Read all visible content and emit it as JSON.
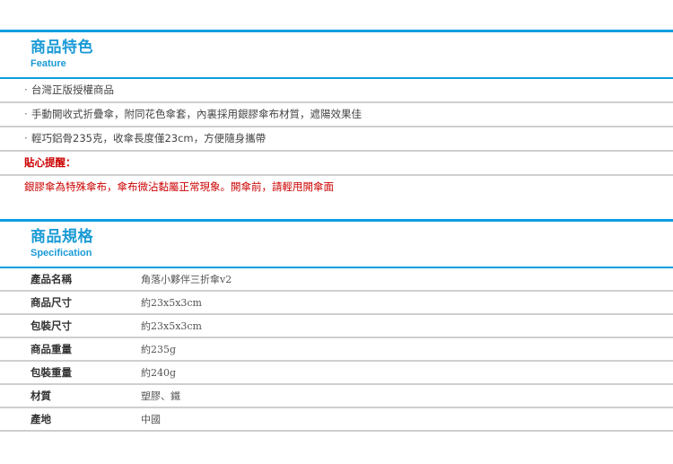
{
  "features_section": {
    "title_zh": "商品特色",
    "title_en": "Feature",
    "bullet_glyph": "·",
    "items": [
      "台灣正版授權商品",
      "手動開收式折疊傘，附同花色傘套，內裏採用銀膠傘布材質，遮陽效果佳",
      "輕巧鋁骨235克，收傘長度僅23cm，方便隨身攜帶"
    ],
    "notice": {
      "title": "貼心提醒：",
      "text": "銀膠傘為特殊傘布，傘布微沾黏屬正常現象。開傘前，請輕甩開傘面",
      "color": "#cc0000"
    }
  },
  "spec_section": {
    "title_zh": "商品規格",
    "title_en": "Specification",
    "rows": [
      {
        "label": "產品名稱",
        "value": "角落小夥伴三折傘v2"
      },
      {
        "label": "商品尺寸",
        "value": "約23x5x3cm"
      },
      {
        "label": "包裝尺寸",
        "value": "約23x5x3cm"
      },
      {
        "label": "商品重量",
        "value": "約235g"
      },
      {
        "label": "包裝重量",
        "value": "約240g"
      },
      {
        "label": "材質",
        "value": "塑膠、鐵"
      },
      {
        "label": "產地",
        "value": "中國"
      }
    ]
  },
  "colors": {
    "accent_blue": "#0b9ee0",
    "heading_blue": "#1a9ad6",
    "divider_grey": "#cfcfcf",
    "notice_red": "#cc0000"
  }
}
